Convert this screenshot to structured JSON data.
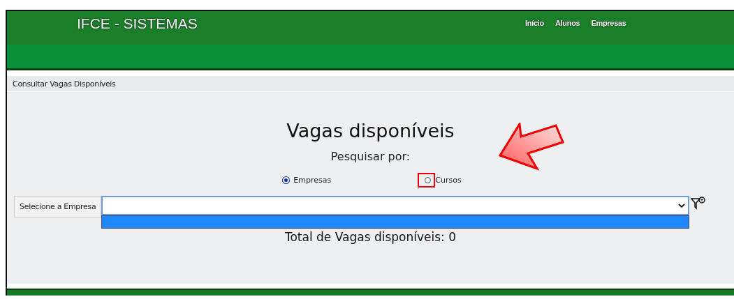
{
  "header": {
    "title": "IFCE - SISTEMAS",
    "nav": [
      {
        "label": "Início"
      },
      {
        "label": "Alunos"
      },
      {
        "label": "Empresas"
      }
    ]
  },
  "breadcrumb": "Consultar Vagas Disponíveis",
  "main": {
    "heading": "Vagas disponíveis",
    "search_label": "Pesquisar por:",
    "options": [
      {
        "label": "Empresas",
        "selected": true,
        "highlighted": false
      },
      {
        "label": "Cursos",
        "selected": false,
        "highlighted": true
      }
    ],
    "select": {
      "label": "Selecione a Empresa",
      "expanded": true
    },
    "total": "Total de Vagas disponíveis: 0"
  }
}
